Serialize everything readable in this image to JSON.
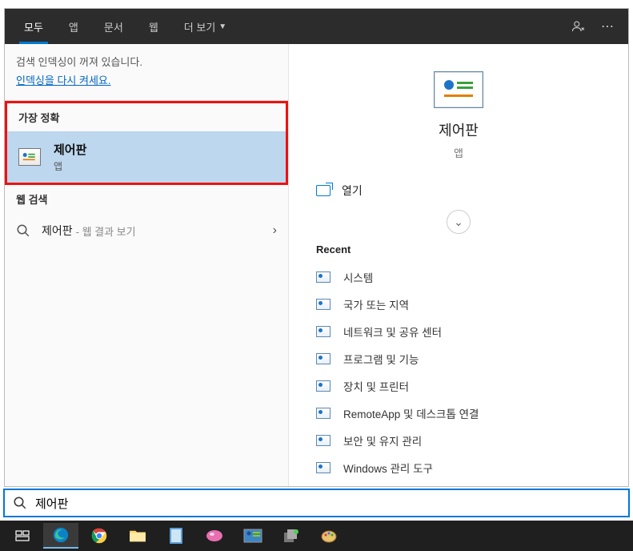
{
  "topbar": {
    "tabs": {
      "all": "모두",
      "apps": "앱",
      "docs": "문서",
      "web": "웹",
      "more": "더 보기"
    }
  },
  "left": {
    "index_off": "검색 인덱싱이 꺼져 있습니다.",
    "index_link": "인덱싱을 다시 켜세요.",
    "best_header": "가장 정확",
    "best_title": "제어판",
    "best_sub": "앱",
    "web_header": "웹 검색",
    "web_term": "제어판",
    "web_sub": "- 웹 결과 보기"
  },
  "right": {
    "title": "제어판",
    "sub": "앱",
    "open": "열기",
    "recent_header": "Recent",
    "recent": [
      "시스템",
      "국가 또는 지역",
      "네트워크 및 공유 센터",
      "프로그램 및 기능",
      "장치 및 프린터",
      "RemoteApp 및 데스크톱 연결",
      "보안 및 유지 관리",
      "Windows 관리 도구"
    ]
  },
  "search_value": "제어판"
}
